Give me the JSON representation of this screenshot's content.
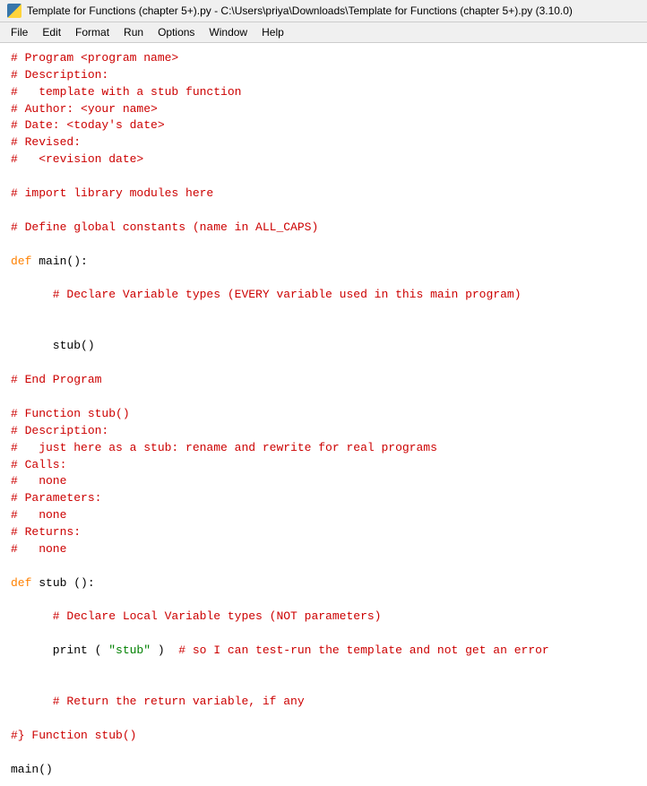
{
  "window": {
    "title": "Template for Functions (chapter 5+).py - C:\\Users\\priya\\Downloads\\Template for Functions (chapter 5+).py (3.10.0)",
    "icon": "python-icon"
  },
  "menubar": {
    "items": [
      "File",
      "Edit",
      "Format",
      "Run",
      "Options",
      "Window",
      "Help"
    ]
  },
  "code": {
    "lines": [
      {
        "type": "comment",
        "text": "# Program <program name>"
      },
      {
        "type": "comment",
        "text": "# Description:"
      },
      {
        "type": "comment",
        "text": "#   template with a stub function"
      },
      {
        "type": "comment",
        "text": "# Author: <your name>"
      },
      {
        "type": "comment",
        "text": "# Date: <today's date>"
      },
      {
        "type": "comment",
        "text": "# Revised:"
      },
      {
        "type": "comment",
        "text": "#   <revision date>"
      },
      {
        "type": "empty"
      },
      {
        "type": "comment",
        "text": "# import library modules here"
      },
      {
        "type": "empty"
      },
      {
        "type": "comment",
        "text": "# Define global constants (name in ALL_CAPS)"
      },
      {
        "type": "empty"
      },
      {
        "type": "mixed",
        "parts": [
          {
            "style": "keyword",
            "text": "def "
          },
          {
            "style": "normal",
            "text": "main():"
          }
        ]
      },
      {
        "type": "empty"
      },
      {
        "type": "comment",
        "text": "      # Declare Variable types (EVERY variable used in this main program)"
      },
      {
        "type": "empty"
      },
      {
        "type": "empty"
      },
      {
        "type": "normal",
        "text": "      stub()"
      },
      {
        "type": "empty"
      },
      {
        "type": "comment",
        "text": "# End Program"
      },
      {
        "type": "empty"
      },
      {
        "type": "comment",
        "text": "# Function stub()"
      },
      {
        "type": "comment",
        "text": "# Description:"
      },
      {
        "type": "comment",
        "text": "#   just here as a stub: rename and rewrite for real programs"
      },
      {
        "type": "comment",
        "text": "# Calls:"
      },
      {
        "type": "comment",
        "text": "#   none"
      },
      {
        "type": "comment",
        "text": "# Parameters:"
      },
      {
        "type": "comment",
        "text": "#   none"
      },
      {
        "type": "comment",
        "text": "# Returns:"
      },
      {
        "type": "comment",
        "text": "#   none"
      },
      {
        "type": "empty"
      },
      {
        "type": "mixed",
        "parts": [
          {
            "style": "keyword",
            "text": "def "
          },
          {
            "style": "normal",
            "text": "stub ():"
          }
        ]
      },
      {
        "type": "empty"
      },
      {
        "type": "comment",
        "text": "      # Declare Local Variable types (NOT parameters)"
      },
      {
        "type": "empty"
      },
      {
        "type": "mixed",
        "parts": [
          {
            "style": "normal",
            "text": "      print ( "
          },
          {
            "style": "string",
            "text": "\"stub\""
          },
          {
            "style": "normal",
            "text": " )  "
          },
          {
            "style": "comment",
            "text": "# so I can test-run the template and not get an error"
          }
        ]
      },
      {
        "type": "empty"
      },
      {
        "type": "empty"
      },
      {
        "type": "comment",
        "text": "      # Return the return variable, if any"
      },
      {
        "type": "empty"
      },
      {
        "type": "comment",
        "text": "#} Function stub()"
      },
      {
        "type": "empty"
      },
      {
        "type": "normal",
        "text": "main()"
      }
    ]
  }
}
